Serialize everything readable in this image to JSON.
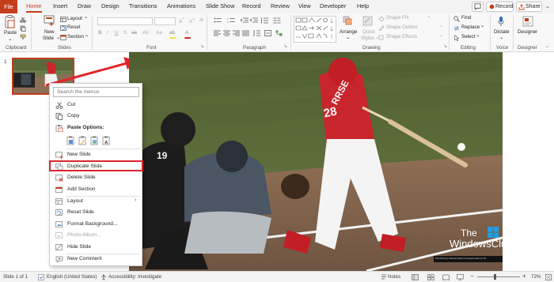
{
  "tabs": [
    "File",
    "Home",
    "Insert",
    "Draw",
    "Design",
    "Transitions",
    "Animations",
    "Slide Show",
    "Record",
    "Review",
    "View",
    "Developer",
    "Help"
  ],
  "top_buttons": {
    "comments_icon": "comment-icon",
    "record": "Record",
    "share": "Share"
  },
  "ribbon": {
    "clipboard": {
      "paste": "Paste",
      "group": "Clipboard"
    },
    "slides": {
      "new_slide": "New\nSlide",
      "new_slide_l1": "New",
      "new_slide_l2": "Slide",
      "layout": "Layout",
      "reset": "Reset",
      "section": "Section",
      "group": "Slides"
    },
    "font": {
      "group": "Font"
    },
    "paragraph": {
      "group": "Paragraph"
    },
    "drawing": {
      "arrange": "Arrange",
      "quick_styles_l1": "Quick",
      "quick_styles_l2": "Styles",
      "shape_fill": "Shape Fill",
      "shape_outline": "Shape Outline",
      "shape_effects": "Shape Effects",
      "group": "Drawing"
    },
    "editing": {
      "find": "Find",
      "replace": "Replace",
      "select": "Select",
      "group": "Editing"
    },
    "voice": {
      "dictate": "Dictate",
      "group": "Voice"
    },
    "designer": {
      "designer": "Designer",
      "group": "Designer"
    }
  },
  "thumbnail": {
    "number": "1"
  },
  "context_menu": {
    "search_placeholder": "Search the menus",
    "cut": "Cut",
    "copy": "Copy",
    "paste_options": "Paste Options:",
    "new_slide": "New Slide",
    "duplicate_slide": "Duplicate Slide",
    "delete_slide": "Delete Slide",
    "add_section": "Add Section",
    "layout": "Layout",
    "reset_slide": "Reset Slide",
    "format_background": "Format Background...",
    "photo_album": "Photo Album...",
    "hide_slide": "Hide Slide",
    "new_comment": "New Comment"
  },
  "slide": {
    "watermark_l1": "The",
    "watermark_l2": "WindowsClub",
    "jersey_name": "RRSE",
    "jersey_number": "28",
    "catcher_number": "19",
    "caption": "This Photo by Unknown Author is licensed under CC BY"
  },
  "statusbar": {
    "slide_info": "Slide 1 of 1",
    "language": "English (United States)",
    "accessibility": "Accessibility: Investigate",
    "notes": "Notes",
    "zoom": "72%"
  },
  "colors": {
    "accent": "#c43e1c",
    "highlight": "#d9252a",
    "arrow": "#e0262b"
  }
}
